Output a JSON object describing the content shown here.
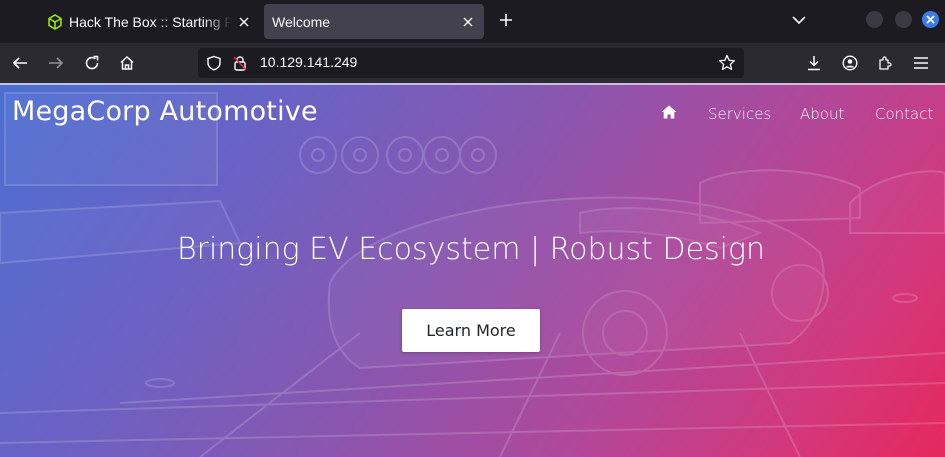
{
  "browser": {
    "tabs": [
      {
        "title": "Hack The Box :: Starting Point",
        "active": false,
        "favicon": "hackthebox-cube-icon",
        "favicon_color": "#9fef00"
      },
      {
        "title": "Welcome",
        "active": true
      }
    ],
    "address_bar": {
      "url": "10.129.141.249",
      "security": "insecure-lock-icon"
    },
    "toolbar_icons": [
      "back-icon",
      "forward-icon",
      "reload-icon",
      "home-icon",
      "bookmark-star-icon",
      "download-icon",
      "account-icon",
      "extensions-icon",
      "menu-icon"
    ]
  },
  "site": {
    "brand": "MegaCorp Automotive",
    "nav": {
      "home_icon": "home-icon",
      "links": [
        "Services",
        "About",
        "Contact"
      ]
    },
    "hero": {
      "headline": "Bringing EV Ecosystem | Robust Design",
      "cta": "Learn More"
    }
  },
  "colors": {
    "gradient_start": "#4d6fd2",
    "gradient_mid": "#a04ca2",
    "gradient_end": "#e5285d",
    "tab_active_bg": "#42414d",
    "urlbar_bg": "#1c1b22",
    "window_close": "#3d7be6"
  }
}
